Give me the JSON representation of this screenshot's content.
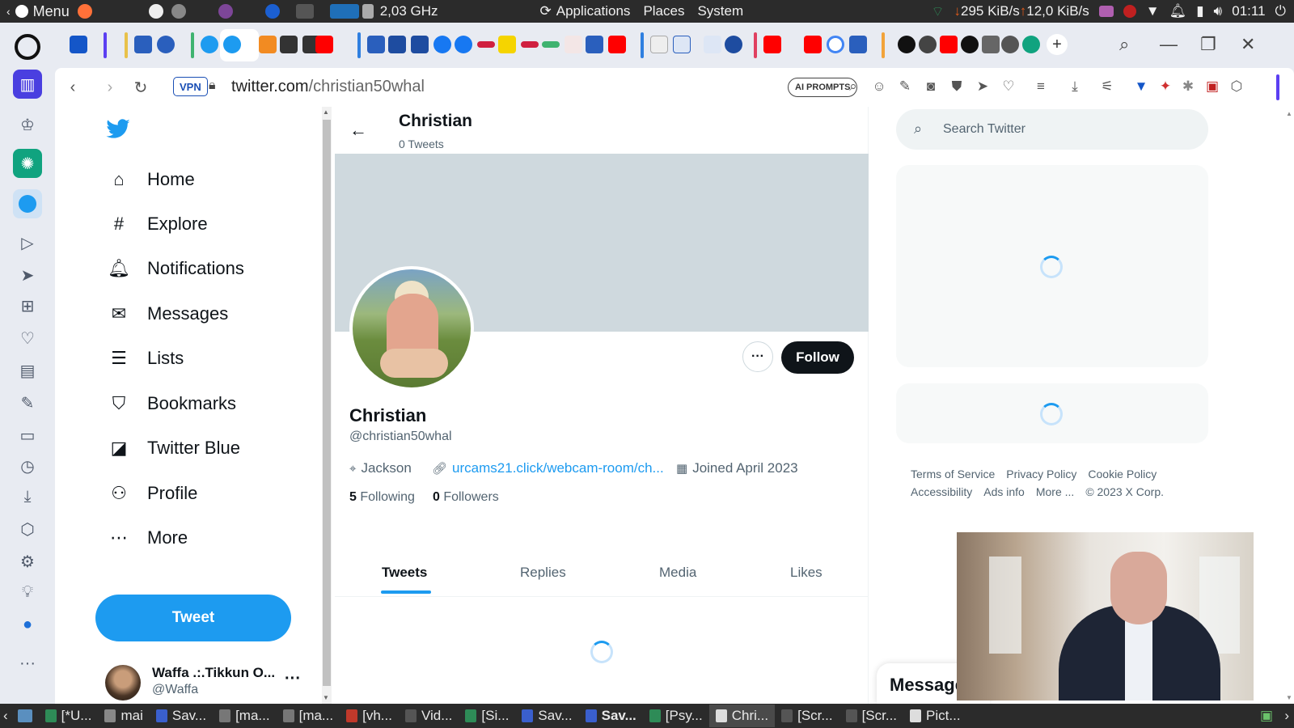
{
  "system_panel": {
    "menu_label": "Menu",
    "cpu_freq": "2,03 GHz",
    "applications_label": "Applications",
    "places_label": "Places",
    "system_label": "System",
    "down_speed": "295 KiB/s",
    "up_speed": "12,0 KiB/s",
    "clock": "01:11"
  },
  "browser": {
    "vpn_label": "VPN",
    "url_host": "twitter.com",
    "url_path": "/christian50whal",
    "ai_prompts_label": "AI PROMPTS"
  },
  "twitter": {
    "nav": [
      {
        "label": "Home",
        "icon": "home-icon",
        "glyph": "⌂"
      },
      {
        "label": "Explore",
        "icon": "hashtag-icon",
        "glyph": "#"
      },
      {
        "label": "Notifications",
        "icon": "bell-icon",
        "glyph": "🔔︎"
      },
      {
        "label": "Messages",
        "icon": "envelope-icon",
        "glyph": "✉"
      },
      {
        "label": "Lists",
        "icon": "list-icon",
        "glyph": "☰"
      },
      {
        "label": "Bookmarks",
        "icon": "bookmark-icon",
        "glyph": "⛉"
      },
      {
        "label": "Twitter Blue",
        "icon": "twitter-blue-icon",
        "glyph": "◪"
      },
      {
        "label": "Profile",
        "icon": "person-icon",
        "glyph": "⚇"
      },
      {
        "label": "More",
        "icon": "more-circle-icon",
        "glyph": "⋯"
      }
    ],
    "tweet_button": "Tweet",
    "account": {
      "name": "Waffa .:.Tikkun O...",
      "handle": "@Waffa",
      "more": "···"
    },
    "profile": {
      "header_name": "Christian",
      "header_tweet_count": "0 Tweets",
      "name": "Christian",
      "handle": "@christian50whal",
      "location": "Jackson",
      "link": "urcams21.click/webcam-room/ch...",
      "joined": "Joined April 2023",
      "following_count": "5",
      "following_label": "Following",
      "followers_count": "0",
      "followers_label": "Followers",
      "follow_button": "Follow",
      "more_button": "···",
      "tabs": [
        "Tweets",
        "Replies",
        "Media",
        "Likes"
      ],
      "active_tab": "Tweets"
    },
    "search_placeholder": "Search Twitter",
    "footer": {
      "row1": [
        "Terms of Service",
        "Privacy Policy",
        "Cookie Policy"
      ],
      "row2": [
        "Accessibility",
        "Ads info",
        "More ...",
        "© 2023 X Corp."
      ]
    },
    "messages_drawer": "Messages"
  },
  "taskbar": {
    "tasks": [
      "[*U...",
      "mai",
      "Sav...",
      "[ma...",
      "[ma...",
      "[vh...",
      "Vid...",
      "[Si...",
      "Sav...",
      "Sav...",
      "[Psy...",
      "Chri...",
      "[Scr...",
      "[Scr...",
      "Pict..."
    ]
  },
  "colors": {
    "twitter_blue": "#1d9bf0",
    "follow_bg": "#0f1419",
    "banner": "#cfd9de",
    "panel_bg": "#2b2b2b"
  }
}
